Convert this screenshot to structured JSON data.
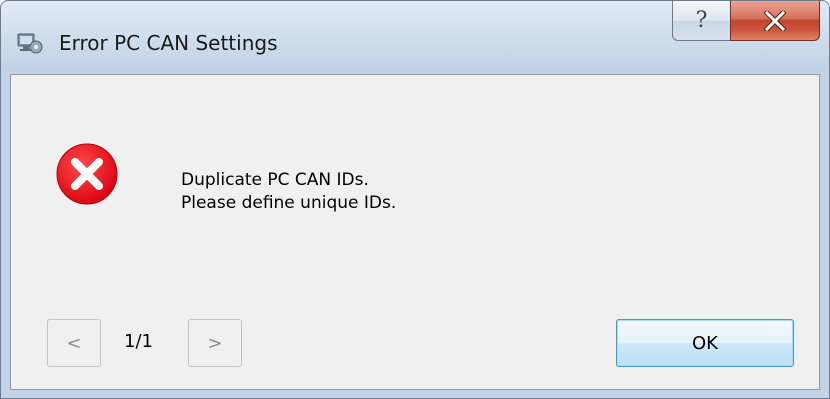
{
  "window": {
    "title": "Error PC CAN Settings",
    "icons": {
      "app": "pc-settings-icon",
      "help": "question-mark-icon",
      "close": "close-x-icon",
      "error": "error-circle-x-icon"
    },
    "help_label": "?",
    "close_color": "#c7452d"
  },
  "dialog": {
    "message_line1": "Duplicate PC CAN IDs.",
    "message_line2": "Please define unique IDs.",
    "error_icon_color": "#e8101c",
    "prev_label": "<",
    "next_label": ">",
    "page_counter": "1/1",
    "ok_label": "OK"
  }
}
